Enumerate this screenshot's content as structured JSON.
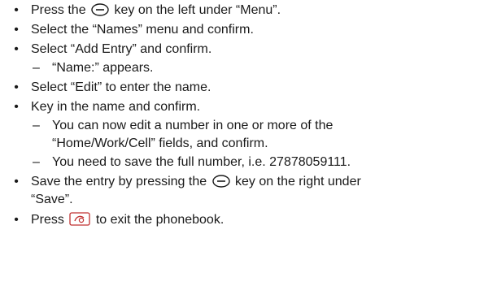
{
  "icons": {
    "soft_key": "soft-key-icon",
    "end_call": "end-call-key-icon"
  },
  "steps": [
    {
      "pre": "Press the",
      "post": "key on the left under “Menu”."
    },
    {
      "text": "Select the “Names” menu and confirm."
    },
    {
      "text": "Select “Add Entry” and confirm."
    },
    {
      "sub": "“Name:” appears."
    },
    {
      "text": "Select “Edit” to enter the name."
    },
    {
      "text": "Key in the name and confirm."
    },
    {
      "sub1_line1": "You can now edit a number in one or more of the",
      "sub1_line2": "“Home/Work/Cell” fields, and confirm."
    },
    {
      "sub2": "You need to save the full number, i.e. 27878059111."
    },
    {
      "pre": "Save the entry by pressing the",
      "post": "key on the right under",
      "cont": "“Save”."
    },
    {
      "pre": "Press",
      "post": "to exit the phonebook."
    }
  ]
}
